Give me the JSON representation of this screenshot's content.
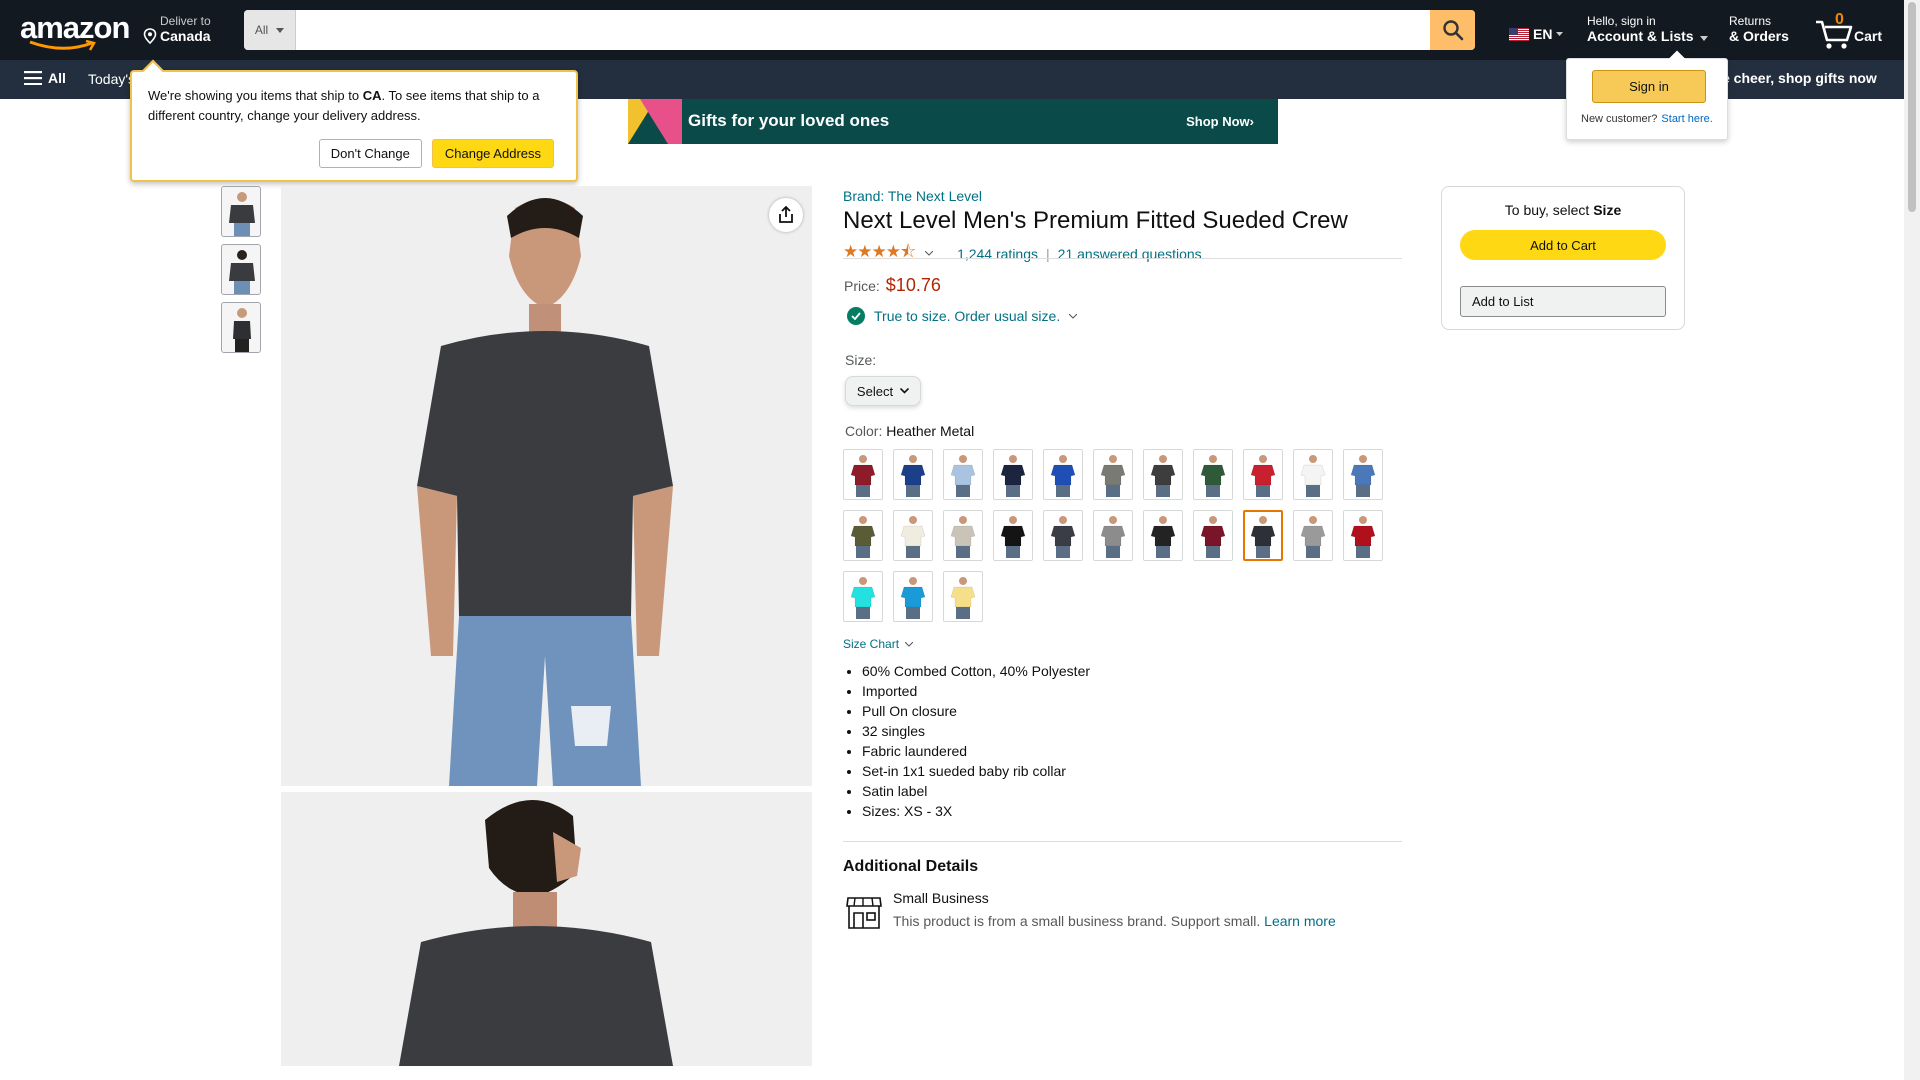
{
  "header": {
    "logo": "amazon",
    "deliver_to_label": "Deliver to",
    "deliver_to_value": "Canada",
    "search_category": "All",
    "search_placeholder": "",
    "language": "EN",
    "account_line1": "Hello, sign in",
    "account_line2": "Account & Lists",
    "returns_line1": "Returns",
    "returns_line2": "& Orders",
    "cart_count": "0",
    "cart_label": "Cart"
  },
  "nav": {
    "all_label": "All",
    "todays_label": "Today's",
    "promo": "e cheer, shop gifts now"
  },
  "delivery_popover": {
    "text_before": "We're showing you items that ship to ",
    "country": "CA",
    "text_after": ". To see items that ship to a different country, change your delivery address.",
    "dont_change": "Don't Change",
    "change_address": "Change Address"
  },
  "signin_flyout": {
    "button": "Sign in",
    "new_customer": "New customer?",
    "start_here": "Start here."
  },
  "banner": {
    "title": "Gifts for your loved ones",
    "cta": "Shop Now›"
  },
  "product": {
    "brand": "Brand: The Next Level",
    "title": "Next Level Men's Premium Fitted Sueded Crew",
    "rating_value": 4.5,
    "ratings_count": "1,244 ratings",
    "answered": "21 answered questions",
    "price_label": "Price:",
    "price": "$10.76",
    "fit": "True to size. Order usual size.",
    "size_label": "Size:",
    "size_select": "Select",
    "color_label": "Color:",
    "color_value": "Heather Metal",
    "size_chart": "Size Chart",
    "bullets": [
      "60% Combed Cotton, 40% Polyester",
      "Imported",
      "Pull On closure",
      "32 singles",
      "Fabric laundered",
      "Set-in 1x1 sueded baby rib collar",
      "Satin label",
      "Sizes: XS - 3X"
    ],
    "additional_details": "Additional Details",
    "small_business_title": "Small Business",
    "small_business_desc": "This product is from a small business brand. Support small.",
    "learn_more": "Learn more"
  },
  "swatch_colors": [
    "#8e1b2a",
    "#1c3f8a",
    "#a9c4e0",
    "#1d2440",
    "#1f4fb5",
    "#7a7a74",
    "#3d3d3d",
    "#2f5a3a",
    "#c8202e",
    "#f4f4f4",
    "#4a78b8",
    "#5a5c36",
    "#f1ece0",
    "#c9c3b8",
    "#141414",
    "#3a3d46",
    "#8c8c8c",
    "#232323",
    "#7a1428",
    "#2e3038",
    "#9a9a9a",
    "#b0101c",
    "#25e0e0",
    "#1a9ad6",
    "#f5df8a"
  ],
  "selected_swatch": 19,
  "buy_box": {
    "prompt": "To buy, select",
    "prompt_bold": "Size",
    "add_to_cart": "Add to Cart",
    "add_to_list": "Add to List"
  }
}
